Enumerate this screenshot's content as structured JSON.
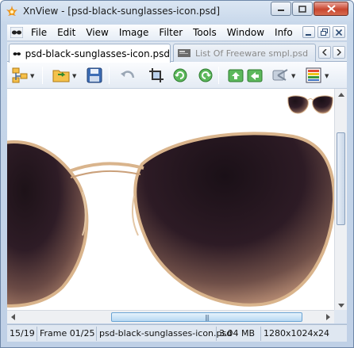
{
  "window": {
    "title": "XnView - [psd-black-sunglasses-icon.psd]"
  },
  "menu": {
    "items": [
      "File",
      "Edit",
      "View",
      "Image",
      "Filter",
      "Tools",
      "Window",
      "Info"
    ]
  },
  "tabs": [
    {
      "label": "psd-black-sunglasses-icon.psd",
      "active": true,
      "icon": "sunglasses-icon"
    },
    {
      "label": "List Of Freeware smpl.psd",
      "active": false,
      "icon": "document-icon"
    }
  ],
  "toolbar": {
    "buttons": [
      "browser-icon",
      "open-folder-icon",
      "save-icon",
      "undo-icon",
      "crop-icon",
      "rotate-left-icon",
      "rotate-right-icon",
      "previous-icon",
      "next-icon",
      "tools-icon",
      "view-mode-icon"
    ]
  },
  "image": {
    "subject": "sunglasses-image",
    "lens_color": "#2a1a22",
    "frame_color": "#d9b48c"
  },
  "status": {
    "index": "15/19",
    "frame": "Frame 01/25",
    "filename": "psd-black-sunglasses-icon.psd",
    "size": "3.04 MB",
    "dimensions": "1280x1024x24"
  },
  "colors": {
    "chrome": "#c7d7ea",
    "close": "#c9462f",
    "accent": "#6aa3d4"
  }
}
